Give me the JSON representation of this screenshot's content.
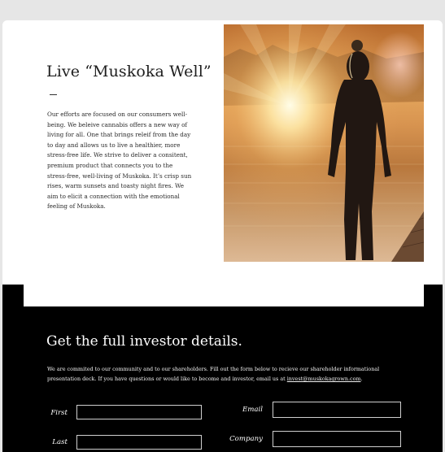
{
  "hero": {
    "title": "Live “Muskoka Well”",
    "body": "Our efforts are focused on our consumers well-being. We beleive cannabis offers a new way of living for all. One that brings releif from the day to day and allows us to live a healthier, more stress-free life.  We strive to deliver  a consitent, premium product that connects you to the stress-free, well-living of Muskoka. It’s crisp sun rises, warm sunsets and toasty night fires. We aim to elicit a connection with the emotional feeling of Muskoka."
  },
  "investor": {
    "title": "Get the full investor details.",
    "body_prefix": "We are commited to our community and to our shareholders. Fill out the form below to recieve our shareholder informational presentation deck. If you have questions or would like to become and investor, email us at ",
    "email_link": "invest@muskokagrown.com",
    "body_suffix": "."
  },
  "form": {
    "first_label": "First",
    "last_label": "Last",
    "email_label": "Email",
    "company_label": "Company",
    "first_value": "",
    "last_value": "",
    "email_value": "",
    "company_value": ""
  },
  "colors": {
    "page_bg": "#e6e6e6",
    "band_bg": "#000000",
    "text_dark": "#1e1e1e"
  }
}
